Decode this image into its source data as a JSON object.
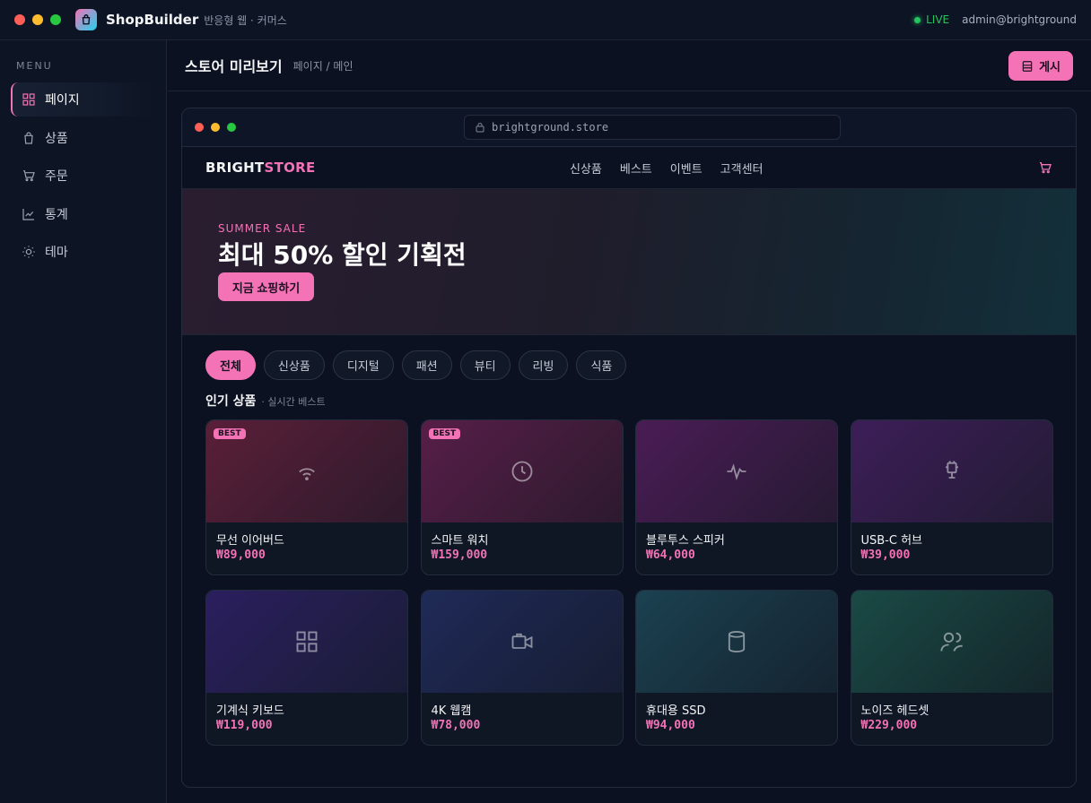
{
  "window": {
    "app_name": "ShopBuilder",
    "app_subtitle": "반응형 웹 · 커머스",
    "live_label": "LIVE",
    "user": "admin@brightground",
    "traffic_colors": [
      "#ff5f57",
      "#febc2e",
      "#28c840"
    ]
  },
  "sidebar": {
    "menu_label": "MENU",
    "items": [
      {
        "label": "페이지",
        "icon": "grid-icon",
        "active": true
      },
      {
        "label": "상품",
        "icon": "bag-icon",
        "active": false
      },
      {
        "label": "주문",
        "icon": "cart-icon",
        "active": false
      },
      {
        "label": "통계",
        "icon": "chart-icon",
        "active": false
      },
      {
        "label": "테마",
        "icon": "sun-icon",
        "active": false
      }
    ]
  },
  "header": {
    "title": "스토어 미리보기",
    "breadcrumb": "페이지 / 메인",
    "publish_label": "게시"
  },
  "browser": {
    "url": "brightground.store"
  },
  "store": {
    "logo_part1": "BRIGHT",
    "logo_part2": "STORE",
    "menu": [
      "신상품",
      "베스트",
      "이벤트",
      "고객센터"
    ],
    "hero": {
      "eyebrow": "SUMMER SALE",
      "title": "최대 50% 할인 기획전",
      "button": "지금 쇼핑하기"
    },
    "chips": [
      "전체",
      "신상품",
      "디지털",
      "패션",
      "뷰티",
      "리빙",
      "식품"
    ],
    "section_title": "인기 상품",
    "section_sub": "· 실시간 베스트",
    "products": [
      {
        "name": "무선 이어버드",
        "price": "₩89,000",
        "badge": "BEST",
        "icon": "wifi-icon"
      },
      {
        "name": "스마트 워치",
        "price": "₩159,000",
        "badge": "BEST",
        "icon": "clock-icon"
      },
      {
        "name": "블루투스 스피커",
        "price": "₩64,000",
        "badge": "",
        "icon": "pulse-icon"
      },
      {
        "name": "USB-C 허브",
        "price": "₩39,000",
        "badge": "",
        "icon": "plug-icon"
      },
      {
        "name": "기계식 키보드",
        "price": "₩119,000",
        "badge": "",
        "icon": "grid-icon"
      },
      {
        "name": "4K 웹캠",
        "price": "₩78,000",
        "badge": "",
        "icon": "camera-icon"
      },
      {
        "name": "휴대용 SSD",
        "price": "₩94,000",
        "badge": "",
        "icon": "database-icon"
      },
      {
        "name": "노이즈 헤드셋",
        "price": "₩229,000",
        "badge": "",
        "icon": "headset-icon"
      }
    ]
  },
  "colors": {
    "accent": "#f472b6",
    "live": "#22c55e",
    "background": "#0b1120"
  }
}
